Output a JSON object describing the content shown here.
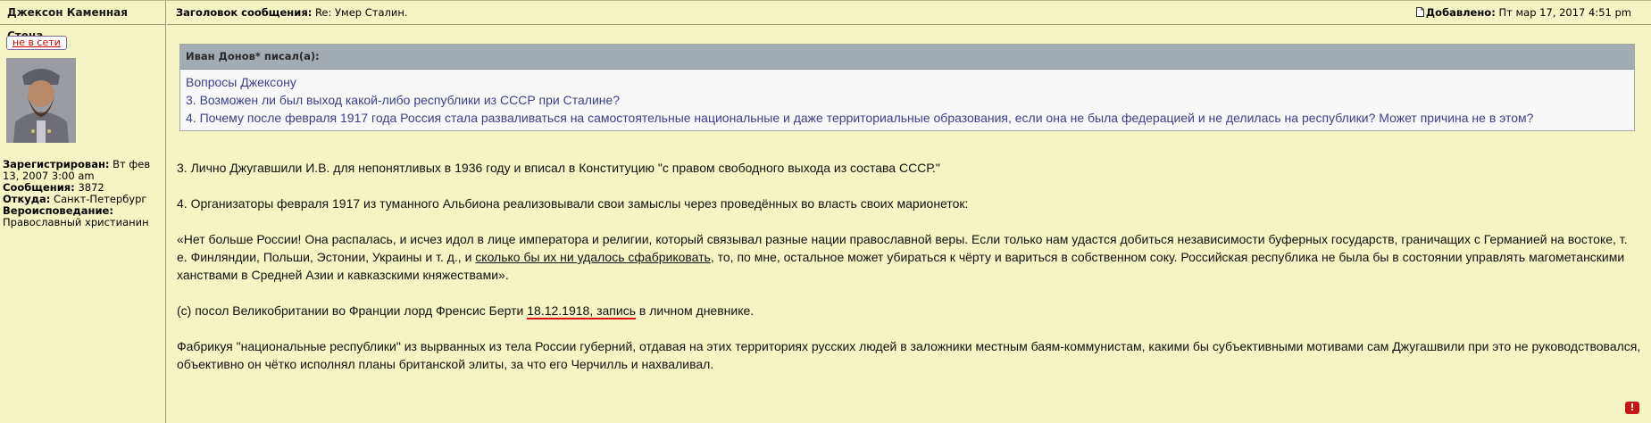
{
  "author": {
    "name": "Джексон Каменная Стена",
    "status": "не в сети",
    "profile": [
      {
        "label": "Зарегистрирован:",
        "value": "Вт фев 13, 2007 3:00 am"
      },
      {
        "label": "Сообщения:",
        "value": "3872"
      },
      {
        "label": "Откуда:",
        "value": "Санкт-Петербург"
      },
      {
        "label": "Вероисповедание:",
        "value": "Православный христианин"
      }
    ]
  },
  "header": {
    "subject_label": "Заголовок сообщения:",
    "subject": "Re: Умер Сталин.",
    "posted_label": "Добавлено:",
    "posted": "Пт мар 17, 2017 4:51 pm"
  },
  "quote": {
    "head": "Иван Донов* писал(а):",
    "lines": [
      "Вопросы Джексону",
      "3. Возможен ли был выход какой-либо республики из СССР при Сталине?",
      "4. Почему после февраля 1917 года Россия стала разваливаться на самостоятельные национальные и даже территориальные образования, если она не была федерацией и не делилась на республики? Может причина не в этом?"
    ]
  },
  "body": {
    "p1": "3. Лично Джугавшили И.В. для непонятливых в 1936 году и вписал в Конституцию \"с правом свободного выхода из состава СССР.\"",
    "p2": "4. Организаторы февраля 1917 из туманного Альбиона реализовывали свои замыслы через проведённых во власть своих марионеток:",
    "p3_a": "«Нет больше России! Она распалась, и исчез идол в лице императора и религии, который связывал разные нации православной веры. Если только нам удастся добиться независимости буферных государств, граничащих с Германией на востоке, т. е. Финляндии, Польши, Эстонии, Украины и т. д., и ",
    "p3_u": "сколько бы их ни удалось сфабриковать",
    "p3_b": ", то, по мне, остальное может убираться к чёрту и вариться в собственном соку. Российская республика не была бы в состоянии управлять магометанскими ханствами в Средней Азии и кавказскими княжествами».",
    "p4_a": "(с) посол Великобритании во Франции лорд Френсис Берти ",
    "p4_u": "18.12.1918, запись",
    "p4_b": " в личном дневнике.",
    "p5": "Фабрикуя \"национальные республики\" из вырванных из тела России губерний, отдавая на этих территориях русских людей в заложники местным баям-коммунистам, какими бы субъективными мотивами сам Джугашвили при это не руководствовался, объективно он чётко исполнял планы британской элиты, за что его Черчилль и нахваливал."
  },
  "icons": {
    "posted": "document-icon",
    "report": "report-icon",
    "report_glyph": "!"
  },
  "colors": {
    "background": "#f4f4c4",
    "quote_text": "#3d3f8a",
    "offline": "#d00000",
    "report": "#c71414"
  }
}
